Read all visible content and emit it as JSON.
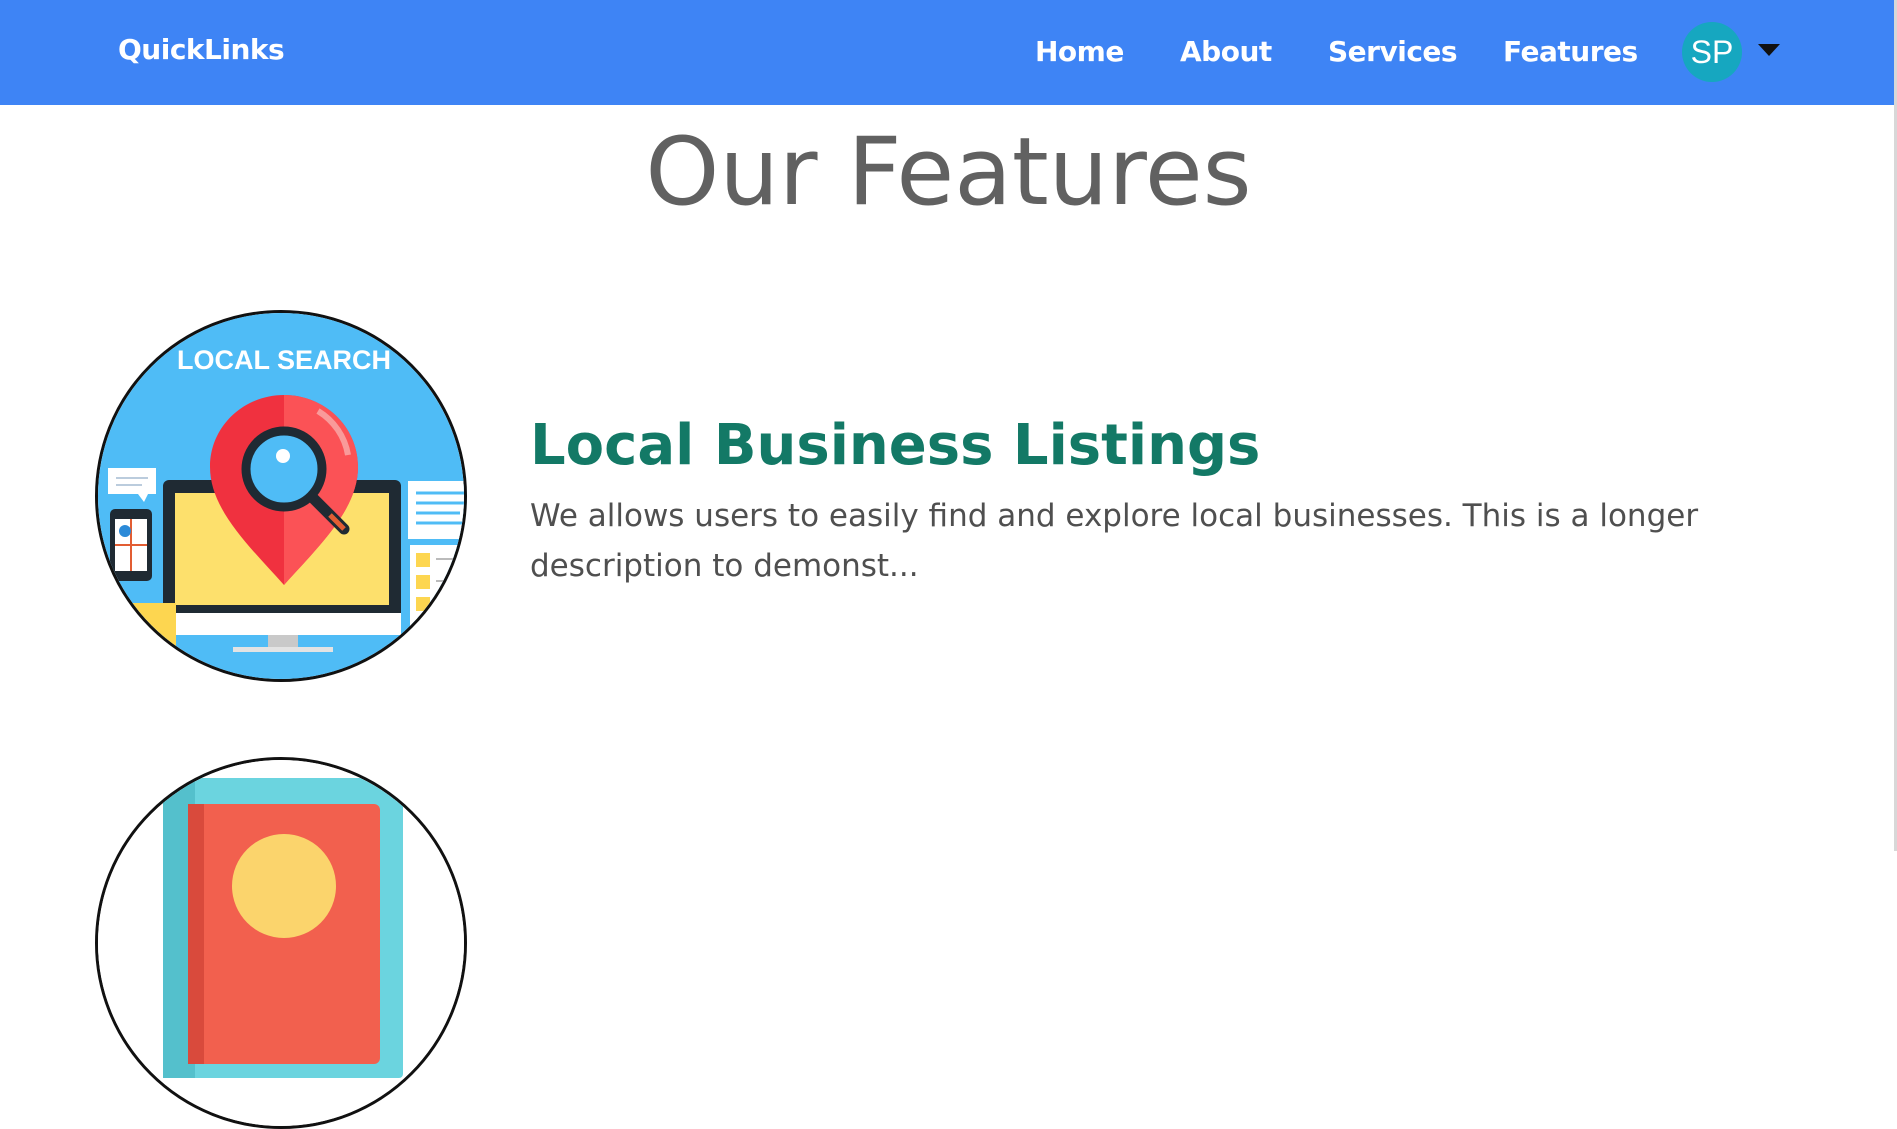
{
  "navbar": {
    "brand": "QuickLinks",
    "links": [
      "Home",
      "About",
      "Services",
      "Features"
    ],
    "user_initials": "SP",
    "accent_color": "#3e84f5",
    "avatar_color": "#16a7c0"
  },
  "page": {
    "title": "Our Features"
  },
  "features": [
    {
      "image_label": "LOCAL SEARCH",
      "title": "Local Business Listings",
      "description": "We allows users to easily find and explore local businesses. This is a longer description to demonst...",
      "icon": "local-search-illustration"
    },
    {
      "icon": "feature-illustration"
    }
  ],
  "colors": {
    "feature_title": "#137966",
    "page_title": "#616161"
  }
}
